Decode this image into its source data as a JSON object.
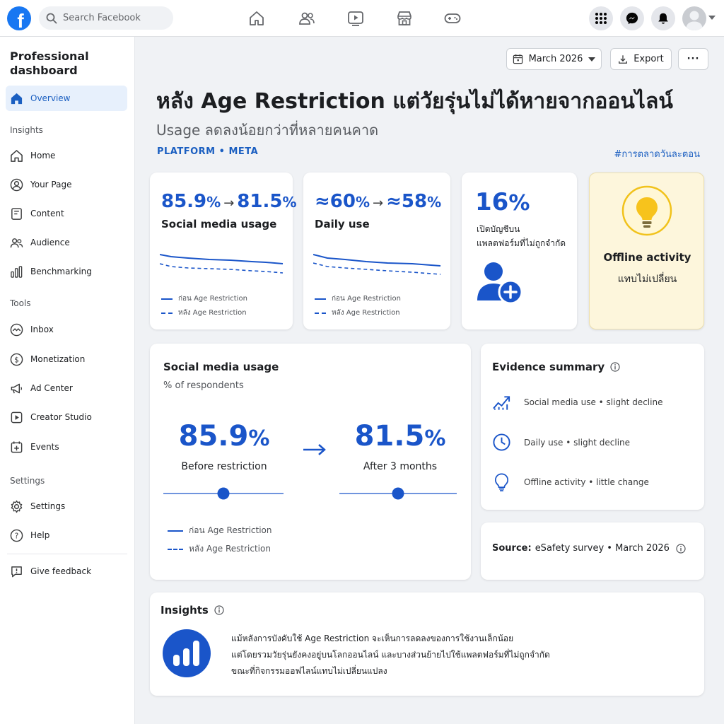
{
  "topbar": {
    "logo": "f",
    "search_placeholder": "Search Facebook",
    "nav_icons": [
      "home-icon",
      "friends-icon",
      "video-icon",
      "marketplace-icon",
      "gaming-icon"
    ],
    "action_icons": [
      "menu-grid-icon",
      "messenger-icon",
      "bell-icon",
      "avatar"
    ]
  },
  "sidebar": {
    "title": "Professional dashboard",
    "overview": "Overview",
    "insights_heading": "Insights",
    "insights_items": [
      "Home",
      "Your Page",
      "Content",
      "Audience",
      "Benchmarking"
    ],
    "tools_heading": "Tools",
    "tools_items": [
      "Inbox",
      "Monetization",
      "Ad Center",
      "Creator Studio",
      "Events"
    ],
    "settings_heading": "Settings",
    "settings_items": [
      "Settings",
      "Help"
    ],
    "feedback": "Give feedback"
  },
  "toolbar": {
    "date_label": "March 2026",
    "export_label": "Export",
    "more_label": "···"
  },
  "header": {
    "headline": "หลัง Age Restriction แต่วัยรุ่นไม่ได้หายจากออนไลน์",
    "subheadline": "Usage ลดลงน้อยกว่าที่หลายคนคาด",
    "platform": "PLATFORM • META",
    "hashtag": "#การตลาดวันละตอน"
  },
  "cards": {
    "social": {
      "before_value": "85.9",
      "after_value": "81.5",
      "unit": "%",
      "arrow": "→",
      "label": "Social media usage"
    },
    "daily": {
      "before_value": "≈60",
      "after_value": "≈58",
      "unit": "%",
      "arrow": "→",
      "label": "Daily use"
    },
    "legend": {
      "before": "ก่อน Age Restriction",
      "after": "หลัง Age Restriction"
    },
    "unrestricted": {
      "value": "16",
      "unit": "%",
      "line1": "เปิดบัญชีบน",
      "line2": "แพลตฟอร์มที่ไม่ถูกจำกัด"
    },
    "offline": {
      "title": "Offline activity",
      "subtitle": "แทบไม่เปลี่ยน"
    }
  },
  "usage_panel": {
    "title": "Social media usage",
    "subtitle": "% of respondents",
    "before_value": "85.9",
    "before_label": "Before restriction",
    "after_value": "81.5",
    "after_label": "After 3 months",
    "unit": "%",
    "legend_before": "ก่อน Age Restriction",
    "legend_after": "หลัง Age Restriction"
  },
  "evidence": {
    "title": "Evidence summary",
    "items": [
      {
        "icon": "trend-down-icon",
        "text": "Social media use • slight decline"
      },
      {
        "icon": "clock-icon",
        "text": "Daily use • slight decline"
      },
      {
        "icon": "lightbulb-icon",
        "text": "Offline activity • little change"
      }
    ]
  },
  "source": {
    "label": "Source:",
    "text": "eSafety survey • March 2026"
  },
  "insights": {
    "title": "Insights",
    "lines": [
      "แม้หลังการบังคับใช้  Age Restriction จะเห็นการลดลงของการใช้งานเล็กน้อย",
      "แต่โดยรวมวัยรุ่นยังคงอยู่บนโลกออนไลน์ และบางส่วนย้ายไปใช้แพลตฟอร์มที่ไม่ถูกจำกัด",
      "ขณะที่กิจกรรมออฟไลน์แทบไม่เปลี่ยนแปลง"
    ]
  },
  "colors": {
    "accent": "#1a55c9",
    "facebook_blue": "#1877f2",
    "offline_card_bg": "#fdf6dc",
    "bulb_yellow": "#f7c31c"
  }
}
